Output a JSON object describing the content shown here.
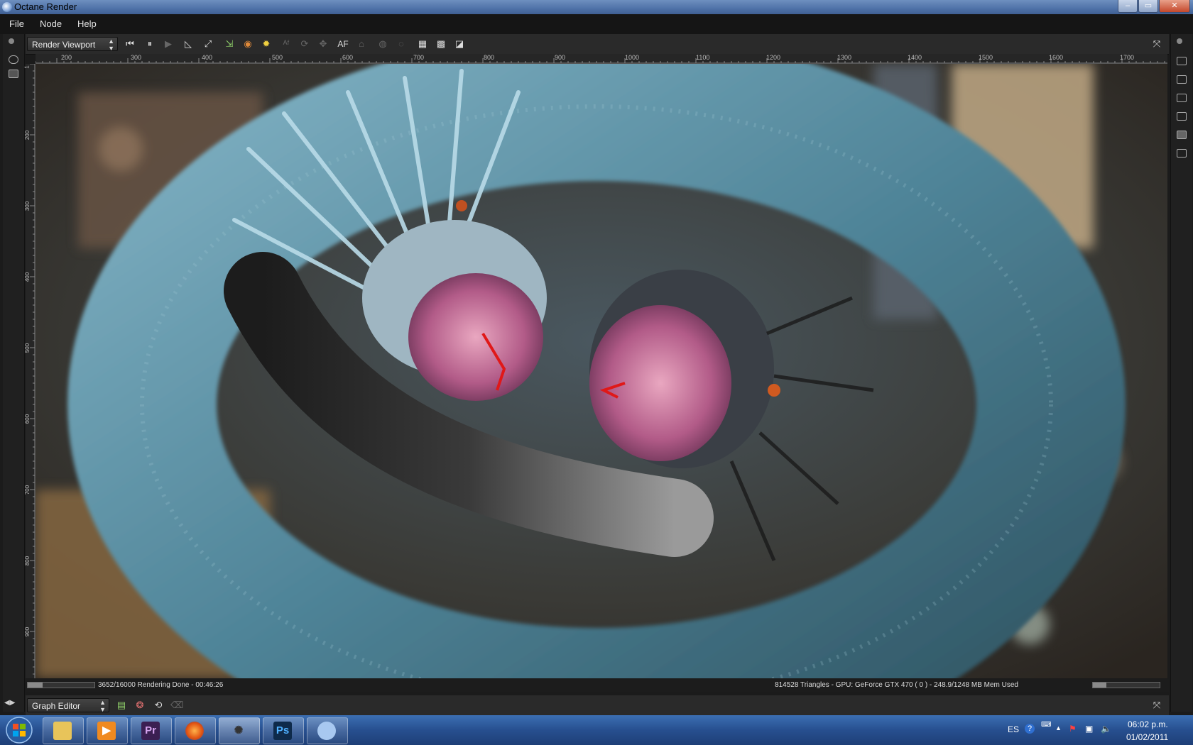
{
  "window": {
    "title": "Octane Render",
    "minimize": "–",
    "maximize": "▭",
    "close": "✕"
  },
  "menu": [
    "File",
    "Node",
    "Help"
  ],
  "toolbar": {
    "view_select": "Render Viewport",
    "af_label": "AF"
  },
  "ruler": {
    "top_ticks": [
      "200",
      "300",
      "400",
      "500",
      "600",
      "700",
      "800",
      "900",
      "1000",
      "1100",
      "1200",
      "1300",
      "1400",
      "1500",
      "1600",
      "1700"
    ],
    "left_ticks": [
      "1",
      "200",
      "300",
      "400",
      "500",
      "600",
      "700",
      "800",
      "900"
    ]
  },
  "status": {
    "progress_text": "3652/16000 Rendering Done - 00:46:26",
    "render_progress": 0.2283,
    "gpu_info": "814528 Triangles - GPU: GeForce GTX 470 ( 0 ) - 248.9/1248 MB Mem Used",
    "mem_used_fraction": 0.199
  },
  "graph_editor": {
    "select": "Graph Editor"
  },
  "taskbar": {
    "apps": [
      {
        "name": "Explorer",
        "label": ""
      },
      {
        "name": "Media Player",
        "label": ""
      },
      {
        "name": "Premiere",
        "label": "Pr"
      },
      {
        "name": "Firefox",
        "label": ""
      },
      {
        "name": "Octane",
        "label": ""
      },
      {
        "name": "Photoshop",
        "label": "Ps"
      },
      {
        "name": "Messenger",
        "label": ""
      }
    ],
    "lang": "ES",
    "time": "06:02 p.m.",
    "date": "01/02/2011"
  },
  "colors": {
    "titlebar": "#4f72a8",
    "panel": "#2a2a2a",
    "taskbar": "#274f8f"
  }
}
